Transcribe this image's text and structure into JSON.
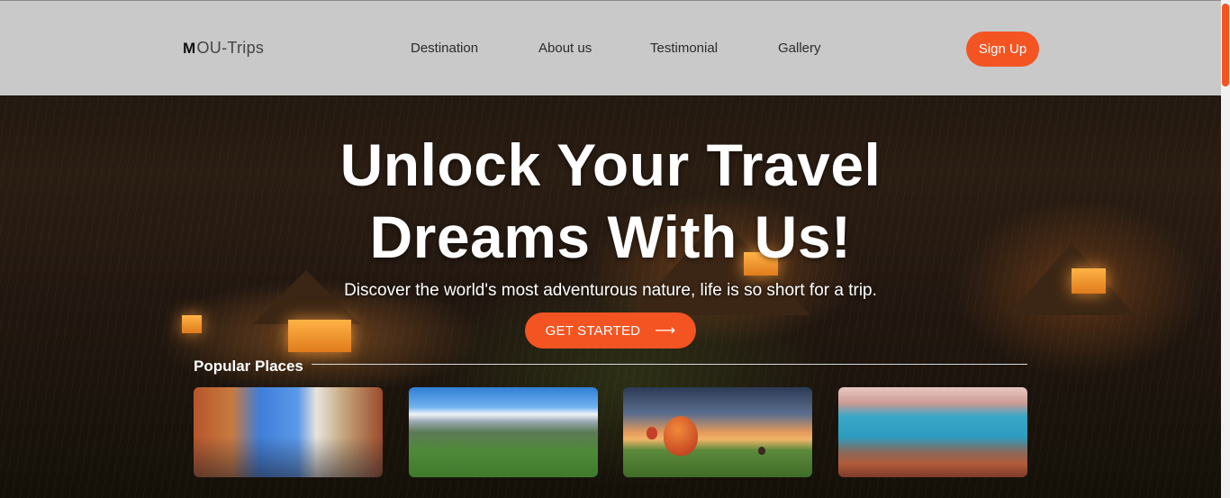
{
  "header": {
    "logo_mark": "M",
    "logo_text": "OU-Trips",
    "nav": [
      "Destination",
      "About us",
      "Testimonial",
      "Gallery"
    ],
    "signup_label": "Sign Up"
  },
  "hero": {
    "title_line1": "Unlock Your Travel",
    "title_line2": "Dreams With Us!",
    "subtitle": "Discover the world's most adventurous nature, life is so short for a trip.",
    "cta_label": "GET STARTED",
    "cta_icon": "arrow-right-icon"
  },
  "popular": {
    "title": "Popular Places",
    "cards": [
      {
        "image": "city-square-photo"
      },
      {
        "image": "mountain-hiker-photo"
      },
      {
        "image": "hot-air-balloons-photo"
      },
      {
        "image": "coastal-town-photo"
      }
    ]
  },
  "colors": {
    "accent": "#f35422",
    "header_bg": "#c9c9c9",
    "text_dark": "#2b2b2b"
  }
}
